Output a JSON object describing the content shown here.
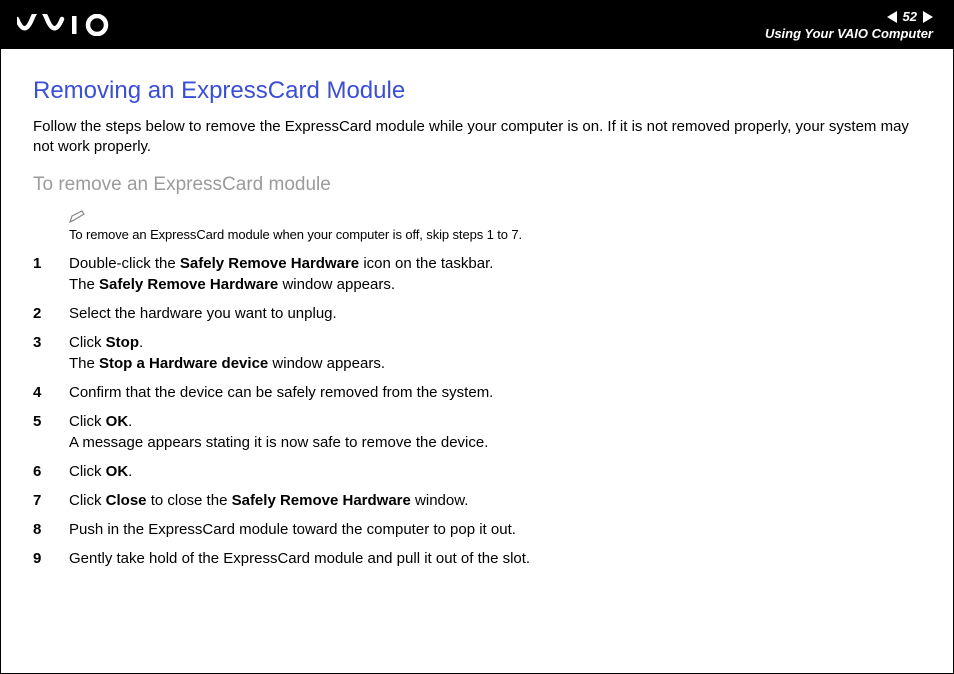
{
  "header": {
    "page_number": "52",
    "section": "Using Your VAIO Computer"
  },
  "title": "Removing an ExpressCard Module",
  "intro": "Follow the steps below to remove the ExpressCard module while your computer is on. If it is not removed properly, your system may not work properly.",
  "subheading": "To remove an ExpressCard module",
  "note": "To remove an ExpressCard module when your computer is off, skip steps 1 to 7.",
  "steps": {
    "n1": "1",
    "n2": "2",
    "n3": "3",
    "n4": "4",
    "n5": "5",
    "n6": "6",
    "n7": "7",
    "n8": "8",
    "n9": "9",
    "s1a": "Double-click the ",
    "s1b": "Safely Remove Hardware",
    "s1c": " icon on the taskbar.",
    "s1d": "The ",
    "s1e": "Safely Remove Hardware",
    "s1f": " window appears.",
    "s2": "Select the hardware you want to unplug.",
    "s3a": "Click ",
    "s3b": "Stop",
    "s3c": ".",
    "s3d": "The ",
    "s3e": "Stop a Hardware device",
    "s3f": " window appears.",
    "s4": "Confirm that the device can be safely removed from the system.",
    "s5a": "Click ",
    "s5b": "OK",
    "s5c": ".",
    "s5d": "A message appears stating it is now safe to remove the device.",
    "s6a": "Click ",
    "s6b": "OK",
    "s6c": ".",
    "s7a": "Click ",
    "s7b": "Close",
    "s7c": " to close the ",
    "s7d": "Safely Remove Hardware",
    "s7e": " window.",
    "s8": "Push in the ExpressCard module toward the computer to pop it out.",
    "s9": "Gently take hold of the ExpressCard module and pull it out of the slot."
  }
}
